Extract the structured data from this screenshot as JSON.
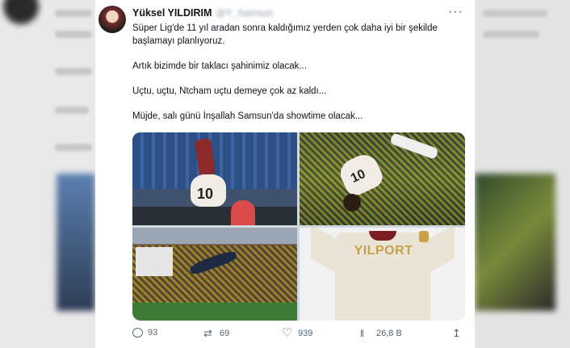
{
  "tweet": {
    "display_name": "Yüksel YILDIRIM",
    "handle": "@Y_Samsun",
    "lines": [
      "Süper Lig'de 11 yıl aradan sonra kaldığımız yerden çok daha iyi bir şekilde",
      "başlamayı planlıyoruz.",
      "",
      "Artık bizimde bir taklacı şahinimiz olacak...",
      "",
      "Uçtu, uçtu, Ntcham uçtu demeye çok az kaldı...",
      "",
      "Müjde, salı günü İnşallah Samsun'da showtime olacak..."
    ]
  },
  "media": {
    "jersey_text": "YILPORT",
    "player_number_1": "10",
    "player_number_2": "10"
  },
  "actions": {
    "replies": "93",
    "retweets": "69",
    "likes": "939",
    "views": "26,8 B"
  },
  "icons": [
    "more-icon",
    "reply-icon",
    "retweet-icon",
    "like-icon",
    "views-icon",
    "share-icon"
  ],
  "colors": {
    "text": "#0f1419",
    "muted": "#536471",
    "jersey_accent": "#c8a24a"
  }
}
